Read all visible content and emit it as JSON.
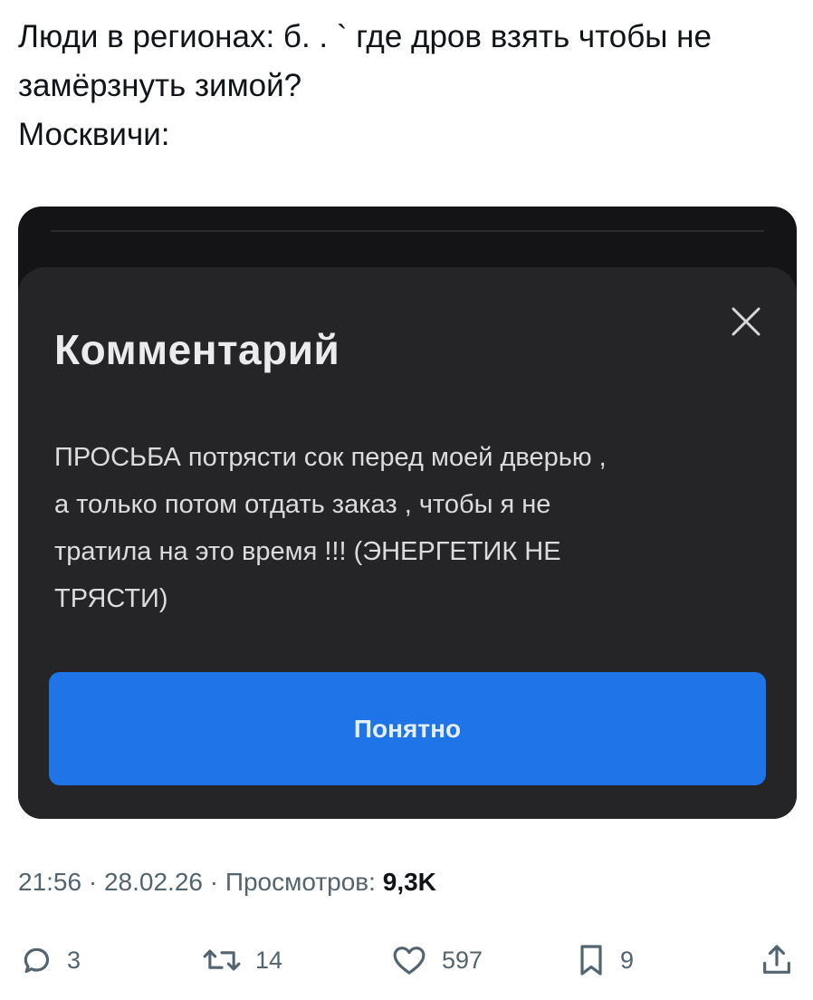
{
  "tweet": {
    "lines": [
      "Люди в регионах: б. . ` где дров взять чтобы не",
      "замёрзнуть зимой?",
      "Москвичи:"
    ]
  },
  "dialog": {
    "title": "Комментарий",
    "message_lines": [
      "ПРОСЬБА потрясти сок перед моей дверью ,",
      "а только потом отдать заказ , чтобы я не",
      "тратила на это время !!! (ЭНЕРГЕТИК НЕ",
      "ТРЯСТИ)"
    ],
    "confirm_label": "Понятно",
    "close_icon": "close-icon",
    "colors": {
      "sheet": "#252528",
      "button": "#1f74e8"
    }
  },
  "meta": {
    "time": "21:56",
    "date": "28.02.26",
    "views_label": "Просмотров:",
    "views_count": "9,3K",
    "separator": "·"
  },
  "actions": {
    "reply": {
      "icon": "reply-icon",
      "count": "3"
    },
    "retweet": {
      "icon": "retweet-icon",
      "count": "14"
    },
    "like": {
      "icon": "heart-icon",
      "count": "597"
    },
    "bookmark": {
      "icon": "bookmark-icon",
      "count": "9"
    },
    "share": {
      "icon": "share-icon"
    }
  }
}
